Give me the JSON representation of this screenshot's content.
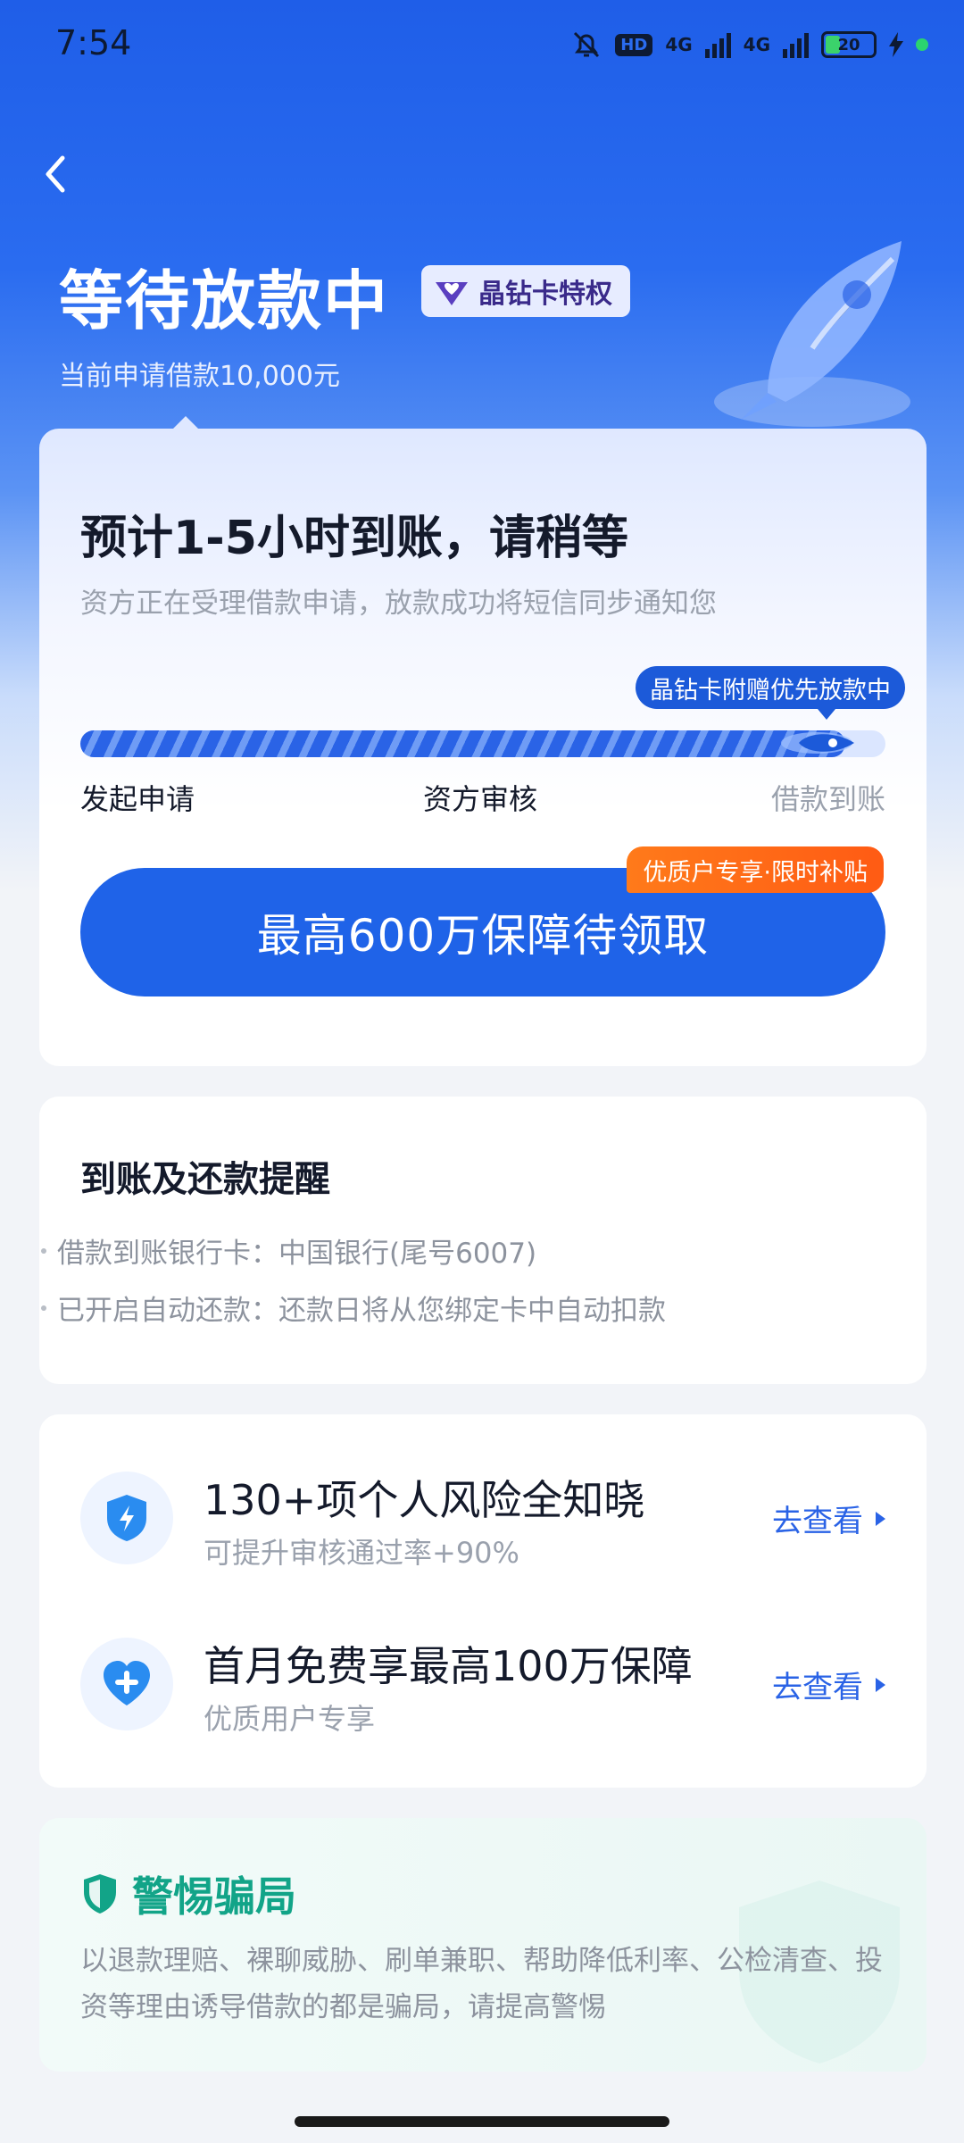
{
  "status_bar": {
    "time": "7:54",
    "hd_label": "HD",
    "network_1": "4G",
    "network_2": "4G",
    "battery": "20"
  },
  "header": {
    "title": "等待放款中",
    "badge": "晶钻卡特权",
    "subtitle": "当前申请借款10,000元"
  },
  "status_card": {
    "eta_title": "预计1-5小时到账，请稍等",
    "eta_desc": "资方正在受理借款申请，放款成功将短信同步通知您",
    "tip_bubble": "晶钻卡附赠优先放款中",
    "progress": 0.95,
    "steps": [
      "发起申请",
      "资方审核",
      "借款到账"
    ],
    "promo_tag": "优质户专享·限时补贴",
    "cta_label": "最高600万保障待领取"
  },
  "reminder_card": {
    "title": "到账及还款提醒",
    "items": [
      "借款到账银行卡：中国银行(尾号6007)",
      "已开启自动还款：还款日将从您绑定卡中自动扣款"
    ]
  },
  "services": [
    {
      "icon": "shield-lightning-icon",
      "title": "130+项个人风险全知晓",
      "subtitle": "可提升审核通过率+90%",
      "link": "去查看"
    },
    {
      "icon": "heart-plus-icon",
      "title": "首月免费享最高100万保障",
      "subtitle": "优质用户专享",
      "link": "去查看"
    }
  ],
  "warning_card": {
    "title": "警惕骗局",
    "text": "以退款理赔、裸聊威胁、刷单兼职、帮助降低利率、公检清查、投资等理由诱导借款的都是骗局，请提高警惕"
  },
  "colors": {
    "brand_blue": "#1f63e8",
    "promo_orange": "#ff6a16",
    "warning_green": "#12a488"
  }
}
